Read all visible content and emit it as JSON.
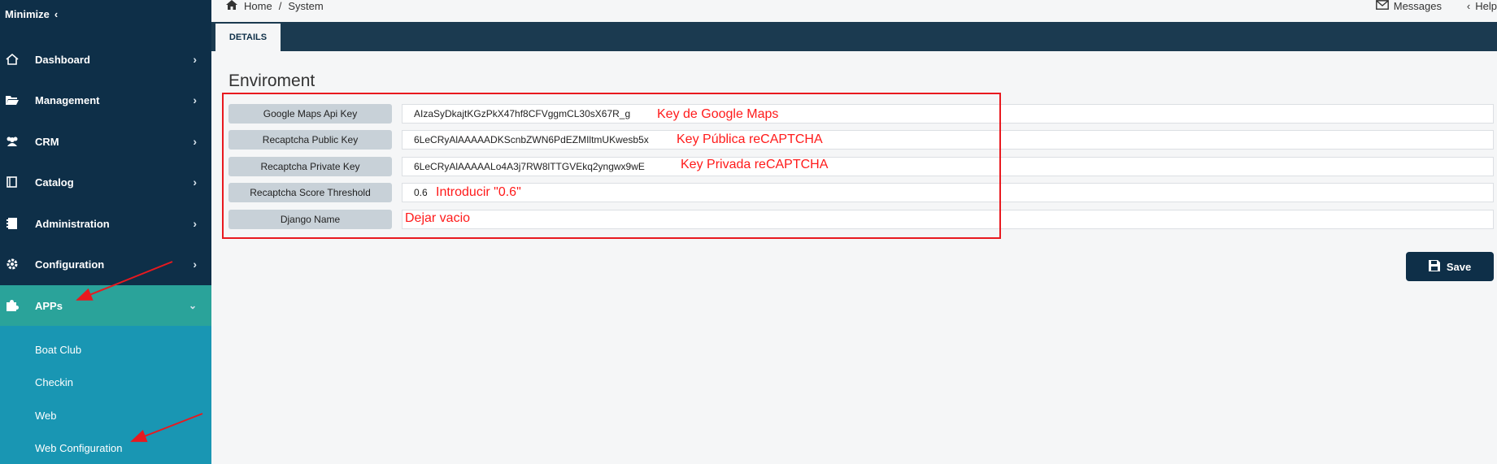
{
  "sidebar": {
    "minimize_label": "Minimize",
    "items": [
      {
        "label": "Dashboard",
        "icon": "home-icon"
      },
      {
        "label": "Management",
        "icon": "folder-open-icon"
      },
      {
        "label": "CRM",
        "icon": "users-icon"
      },
      {
        "label": "Catalog",
        "icon": "book-icon"
      },
      {
        "label": "Administration",
        "icon": "notebook-icon"
      },
      {
        "label": "Configuration",
        "icon": "gear-icon"
      },
      {
        "label": "APPs",
        "icon": "puzzle-icon",
        "active": true
      }
    ],
    "apps_subitems": [
      "Boat Club",
      "Checkin",
      "Web",
      "Web Configuration"
    ]
  },
  "topbar": {
    "breadcrumb_home": "Home",
    "breadcrumb_separator": "/",
    "breadcrumb_current": "System",
    "messages_label": "Messages",
    "help_label": "Help"
  },
  "tabs": {
    "details_label": "DETAILS"
  },
  "section": {
    "title": "Enviroment"
  },
  "fields": [
    {
      "label": "Google Maps Api Key",
      "value": "AIzaSyDkajtKGzPkX47hf8CFVggmCL30sX67R_g",
      "annotation": "Key de Google Maps"
    },
    {
      "label": "Recaptcha Public Key",
      "value": "6LeCRyAlAAAAADKScnbZWN6PdEZMIltmUKwesb5x",
      "annotation": "Key Pública reCAPTCHA"
    },
    {
      "label": "Recaptcha Private Key",
      "value": "6LeCRyAlAAAAALo4A3j7RW8lTTGVEkq2yngwx9wE",
      "annotation": "Key Privada reCAPTCHA"
    },
    {
      "label": "Recaptcha Score Threshold",
      "value": "0.6",
      "annotation": "Introducir \"0.6\""
    },
    {
      "label": "Django Name",
      "value": "",
      "annotation": "Dejar vacio"
    }
  ],
  "actions": {
    "save_label": "Save"
  },
  "colors": {
    "sidebar_bg": "#0e2f48",
    "active_item_bg": "#2aa39a",
    "submenu_bg": "#1996b3",
    "annotation_red": "#e8191f"
  }
}
